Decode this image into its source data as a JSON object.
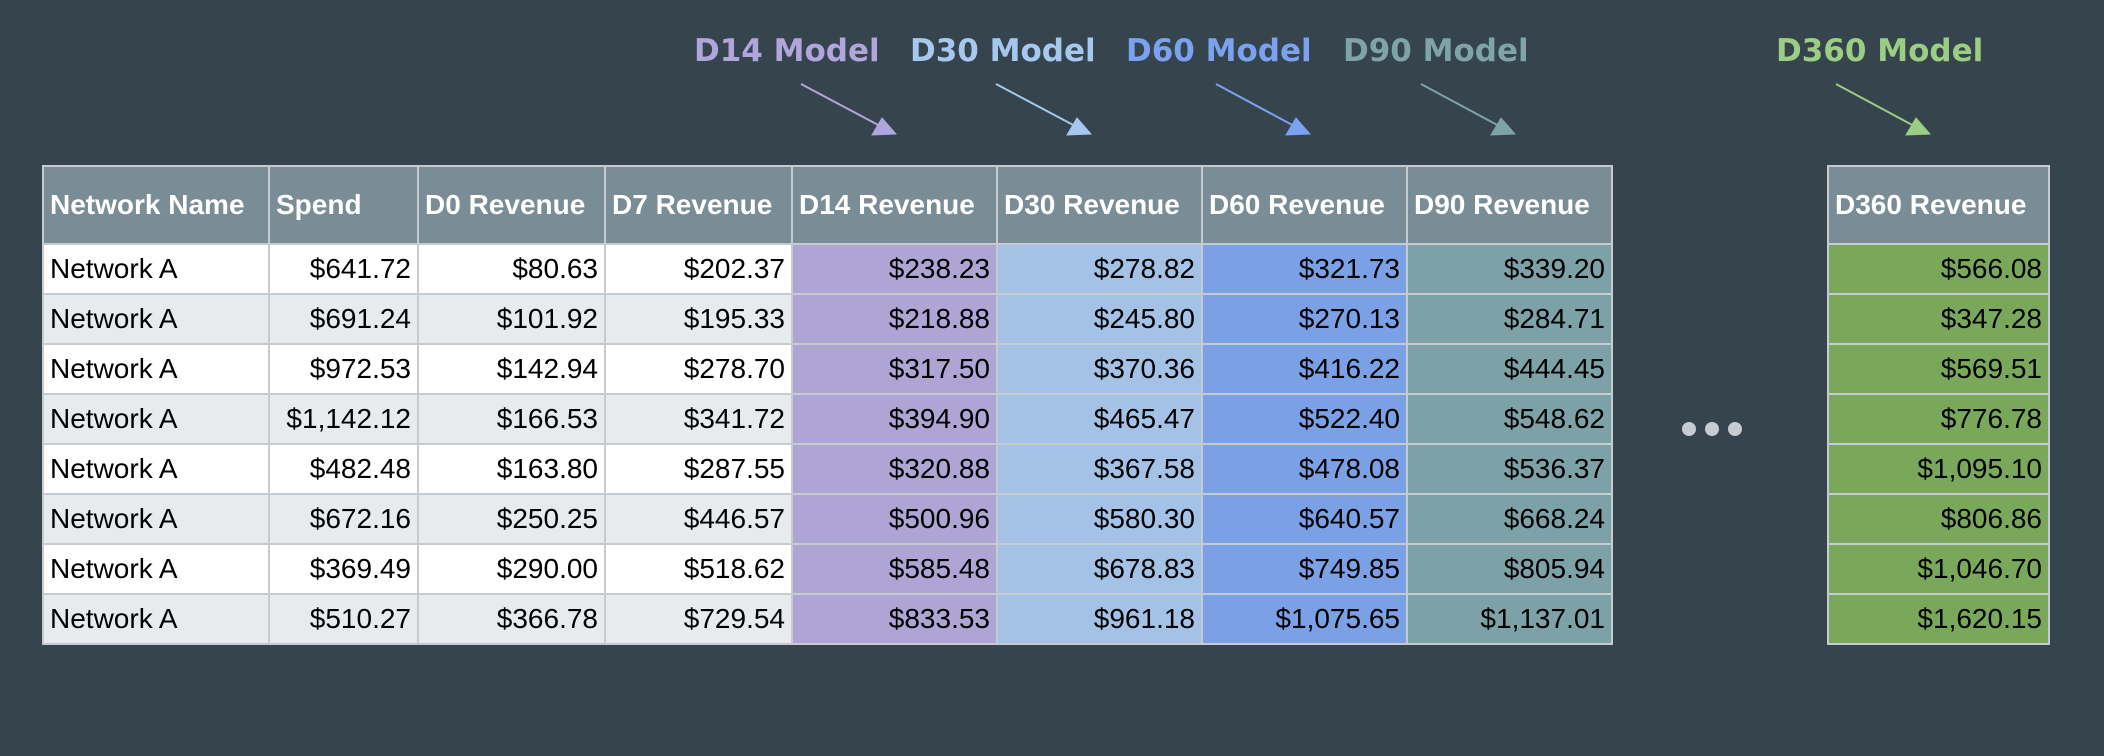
{
  "models": [
    {
      "key": "d14",
      "label": "D14 Model",
      "color": "#b0a6db"
    },
    {
      "key": "d30",
      "label": "D30 Model",
      "color": "#a7c8ee"
    },
    {
      "key": "d60",
      "label": "D60 Model",
      "color": "#7aa2ee"
    },
    {
      "key": "d90",
      "label": "D90 Model",
      "color": "#7ea3a8"
    },
    {
      "key": "d360",
      "label": "D360 Model",
      "color": "#9ccd84"
    }
  ],
  "table": {
    "headers": [
      "Network Name",
      "Spend",
      "D0 Revenue",
      "D7 Revenue",
      "D14 Revenue",
      "D30 Revenue",
      "D60 Revenue",
      "D90 Revenue"
    ],
    "rows": [
      [
        "Network A",
        "$641.72",
        "$80.63",
        "$202.37",
        "$238.23",
        "$278.82",
        "$321.73",
        "$339.20"
      ],
      [
        "Network A",
        "$691.24",
        "$101.92",
        "$195.33",
        "$218.88",
        "$245.80",
        "$270.13",
        "$284.71"
      ],
      [
        "Network A",
        "$972.53",
        "$142.94",
        "$278.70",
        "$317.50",
        "$370.36",
        "$416.22",
        "$444.45"
      ],
      [
        "Network A",
        "$1,142.12",
        "$166.53",
        "$341.72",
        "$394.90",
        "$465.47",
        "$522.40",
        "$548.62"
      ],
      [
        "Network A",
        "$482.48",
        "$163.80",
        "$287.55",
        "$320.88",
        "$367.58",
        "$478.08",
        "$536.37"
      ],
      [
        "Network A",
        "$672.16",
        "$250.25",
        "$446.57",
        "$500.96",
        "$580.30",
        "$640.57",
        "$668.24"
      ],
      [
        "Network A",
        "$369.49",
        "$290.00",
        "$518.62",
        "$585.48",
        "$678.83",
        "$749.85",
        "$805.94"
      ],
      [
        "Network A",
        "$510.27",
        "$366.78",
        "$729.54",
        "$833.53",
        "$961.18",
        "$1,075.65",
        "$1,137.01"
      ]
    ]
  },
  "d360_table": {
    "header": "D360 Revenue",
    "values": [
      "$566.08",
      "$347.28",
      "$569.51",
      "$776.78",
      "$1,095.10",
      "$806.86",
      "$1,046.70",
      "$1,620.15"
    ]
  },
  "colors": {
    "background": "#36444d",
    "header_gray": "#7a8c96",
    "d14_column": "#afa5d5",
    "d30_column": "#a3c2e6",
    "d60_column": "#7aa0e6",
    "d90_column": "#7ca2a8",
    "d360_column": "#7aa85a",
    "ellipsis": "#c6ccd1"
  }
}
